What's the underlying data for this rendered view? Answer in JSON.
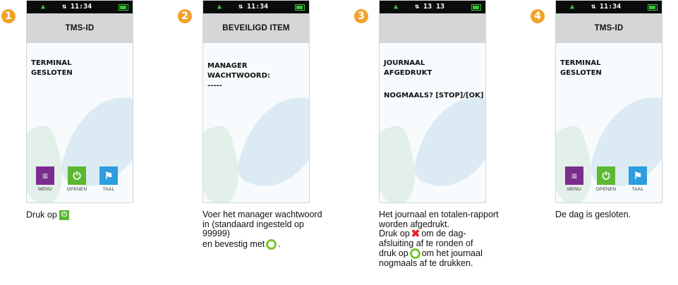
{
  "colors": {
    "badge": "#f0a32a",
    "menu": "#7b2d8e",
    "open": "#5cb831",
    "lang": "#2d9ce0"
  },
  "steps": [
    {
      "number": "1",
      "status": {
        "time": "11:34"
      },
      "title": "TMS-ID",
      "message": [
        "TERMINAL",
        "GESLOTEN"
      ],
      "buttons": [
        {
          "label": "MENU",
          "icon": "list-icon"
        },
        {
          "label": "OPENEN",
          "icon": "power-icon"
        },
        {
          "label": "TAAL",
          "icon": "flag-icon"
        }
      ],
      "caption": {
        "text1": "Druk op"
      }
    },
    {
      "number": "2",
      "status": {
        "time": "11:34"
      },
      "title": "BEVEILIGD ITEM",
      "message": [
        "MANAGER WACHTWOORD:",
        "-----"
      ],
      "caption": {
        "text1": "Voer het manager wachtwoord in (standaard ingesteld op 99999)",
        "text2": "en bevestig met",
        "text3": "."
      }
    },
    {
      "number": "3",
      "status": {
        "time": "13 13"
      },
      "title": "",
      "message": [
        "JOURNAAL",
        "AFGEDRUKT",
        "NOGMAALS? [STOP]/[OK]"
      ],
      "caption": {
        "text1": "Het journaal en totalen-rapport worden afgedrukt.",
        "text2": "Druk op",
        "text3": "om de dag-afsluiting af te ronden of",
        "text4": "druk op",
        "text5": "om het journaal nogmaals af te drukken."
      }
    },
    {
      "number": "4",
      "status": {
        "time": "11:34"
      },
      "title": "TMS-ID",
      "message": [
        "TERMINAL",
        "GESLOTEN"
      ],
      "buttons": [
        {
          "label": "MENU",
          "icon": "list-icon"
        },
        {
          "label": "OPENEN",
          "icon": "power-icon"
        },
        {
          "label": "TAAL",
          "icon": "flag-icon"
        }
      ],
      "caption": {
        "text1": "De dag is gesloten."
      }
    }
  ]
}
